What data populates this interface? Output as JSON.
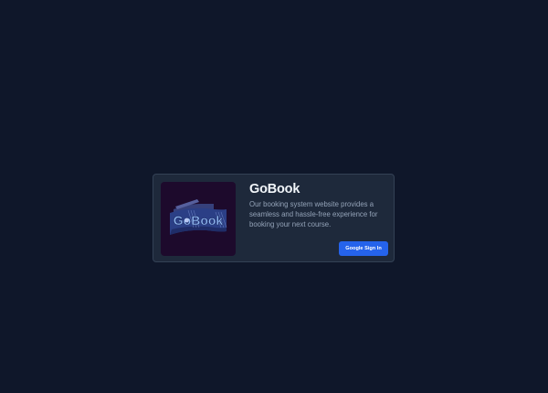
{
  "card": {
    "title": "GoBook",
    "description": "Our booking system website provides a seamless and hassle-free experience for booking your next course.",
    "logo": {
      "icon": "gobook-logo",
      "wordmark": "GoBook"
    },
    "sign_in_button_label": "Google Sign In"
  },
  "colors": {
    "page_background": "#0f172a",
    "card_background": "#1e293b",
    "logo_background": "#1d0a2c",
    "accent": "#2563eb",
    "title_text": "#f1f5f9",
    "body_text": "#94a3b8"
  }
}
